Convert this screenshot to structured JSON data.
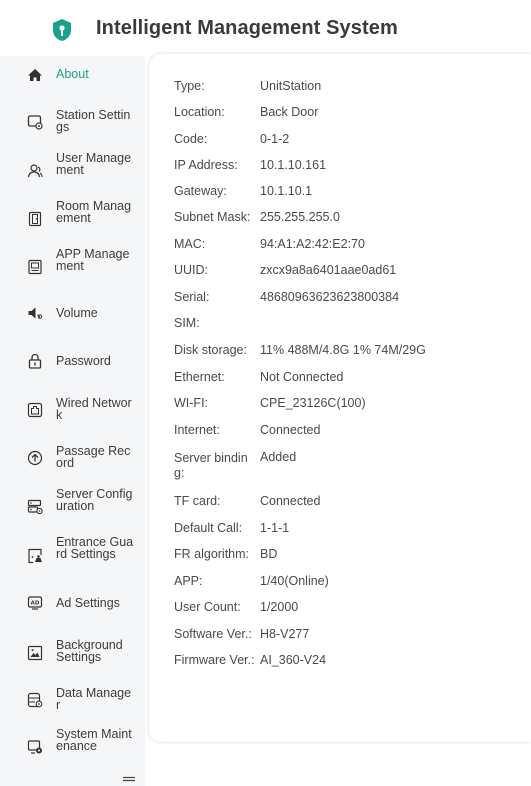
{
  "app": {
    "title": "Intelligent Management System"
  },
  "colors": {
    "accent": "#1aa28c",
    "sidebar_bg": "#f5f6f8",
    "panel_bg": "#ffffff"
  },
  "sidebar": {
    "items": [
      {
        "label": "About",
        "icon": "home-icon",
        "active": true
      },
      {
        "label": "Station Settings",
        "icon": "station-settings-icon"
      },
      {
        "label": "User Management",
        "icon": "user-icon"
      },
      {
        "label": "Room Management",
        "icon": "door-icon"
      },
      {
        "label": "APP Management",
        "icon": "app-icon"
      },
      {
        "label": "Volume",
        "icon": "volume-icon"
      },
      {
        "label": "Password",
        "icon": "lock-icon"
      },
      {
        "label": "Wired Network",
        "icon": "network-icon"
      },
      {
        "label": "Passage Record",
        "icon": "record-icon"
      },
      {
        "label": "Server Configuration",
        "icon": "server-icon"
      },
      {
        "label": "Entrance Guard Settings",
        "icon": "entrance-guard-icon"
      },
      {
        "label": "Ad Settings",
        "icon": "ad-icon"
      },
      {
        "label": "Background Settings",
        "icon": "image-icon"
      },
      {
        "label": "Data Manager",
        "icon": "database-icon"
      },
      {
        "label": "System Maintenance",
        "icon": "maintenance-icon"
      }
    ]
  },
  "about": {
    "rows": [
      {
        "key": "Type:",
        "value": "UnitStation"
      },
      {
        "key": "Location:",
        "value": "Back Door"
      },
      {
        "key": "Code:",
        "value": "0-1-2"
      },
      {
        "key": "IP Address:",
        "value": "10.1.10.161"
      },
      {
        "key": "Gateway:",
        "value": "10.1.10.1"
      },
      {
        "key": "Subnet Mask:",
        "value": "255.255.255.0"
      },
      {
        "key": "MAC:",
        "value": "94:A1:A2:42:E2:70"
      },
      {
        "key": "UUID:",
        "value": "zxcx9a8a6401aae0ad61"
      },
      {
        "key": "Serial:",
        "value": "48680963623623800384"
      },
      {
        "key": "SIM:",
        "value": ""
      },
      {
        "key": "Disk storage:",
        "value": "11% 488M/4.8G 1% 74M/29G"
      },
      {
        "key": "Ethernet:",
        "value": "Not Connected"
      },
      {
        "key": "WI-FI:",
        "value": "CPE_23126C(100)"
      },
      {
        "key": "Internet:",
        "value": "Connected"
      },
      {
        "key": "Server binding:",
        "value": "Added"
      },
      {
        "key": "TF card:",
        "value": "Connected"
      },
      {
        "key": "Default Call:",
        "value": "1-1-1"
      },
      {
        "key": "FR algorithm:",
        "value": "BD"
      },
      {
        "key": "APP:",
        "value": "1/40(Online)"
      },
      {
        "key": "User Count:",
        "value": "1/2000"
      },
      {
        "key": "Software Ver.:",
        "value": "H8-V277"
      },
      {
        "key": "Firmware Ver.:",
        "value": "AI_360-V24"
      }
    ]
  }
}
